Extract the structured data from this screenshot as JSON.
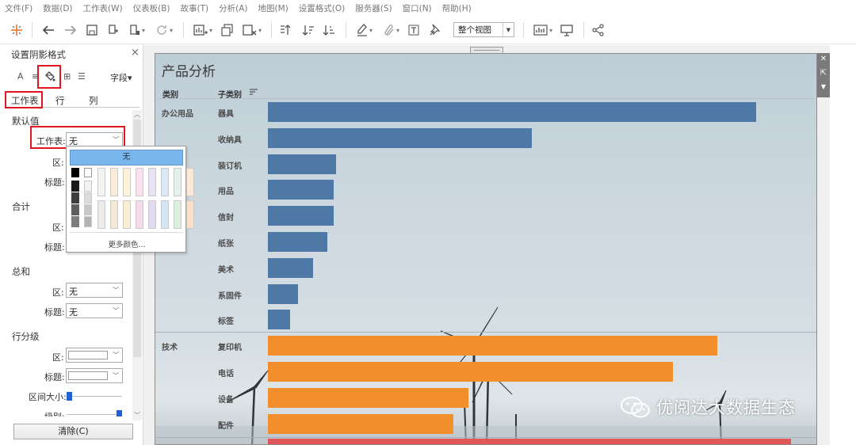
{
  "menubar": [
    "文件(F)",
    "数据(D)",
    "工作表(W)",
    "仪表板(B)",
    "故事(T)",
    "分析(A)",
    "地图(M)",
    "设置格式(O)",
    "服务器(S)",
    "窗口(N)",
    "帮助(H)"
  ],
  "toolbar": {
    "view_select": "整个视图",
    "icons": [
      "tableau-logo-icon",
      "undo-icon",
      "redo-icon",
      "save-icon",
      "new-datasource-icon",
      "pause-update-icon",
      "refresh-icon",
      "new-worksheet-icon",
      "duplicate-sheet-icon",
      "clear-sheet-icon",
      "swap-axes-icon",
      "sort-ascending-icon",
      "sort-descending-icon",
      "highlight-icon",
      "group-icon",
      "show-labels-icon",
      "pin-axes-icon",
      "show-me-icon",
      "presentation-icon",
      "share-icon"
    ]
  },
  "format_pane": {
    "title": "设置阴影格式",
    "close": "×",
    "tab_icons": [
      "A",
      "≡",
      "◈",
      "⊞",
      "☰"
    ],
    "field_dropdown": "字段▾",
    "subtabs": [
      "工作表",
      "行",
      "列"
    ],
    "sections": {
      "default": {
        "title": "默认值",
        "worksheet_label": "工作表:",
        "worksheet_value": "无",
        "area_label": "区:",
        "header_label": "标题:"
      },
      "total": {
        "title": "合计",
        "area_label": "区:",
        "header_label": "标题:"
      },
      "grand_total": {
        "title": "总和",
        "area_label": "区:",
        "area_value": "无",
        "header_label": "标题:",
        "header_value": "无"
      },
      "row_banding": {
        "title": "行分级",
        "area_label": "区:",
        "header_label": "标题:",
        "band_size_label": "区间大小:",
        "level_label": "级别:",
        "band_size_value": 0,
        "level_value": 1
      }
    },
    "clear_button": "清除(C)"
  },
  "palette": {
    "none_label": "无",
    "more_colors": "更多颜色...",
    "colors": {
      "black": "#000000",
      "white": "#ffffff",
      "selected_blue": "#79b6ec"
    }
  },
  "sheet": {
    "title": "产品分析",
    "col_headers": [
      "类别",
      "子类别"
    ],
    "sort_icon": "sort-icon",
    "colors": {
      "office": "#4e79a7",
      "tech": "#f28e2b",
      "furniture": "#e15759"
    }
  },
  "chart_data": {
    "type": "bar",
    "orientation": "horizontal",
    "groups": [
      {
        "name": "办公用品",
        "categories": [
          "器具",
          "收纳具",
          "装订机",
          "用品",
          "信封",
          "纸张",
          "美术",
          "系固件",
          "标签"
        ],
        "values": [
          100,
          54,
          14,
          13.5,
          13.5,
          12.2,
          9.2,
          6.1,
          4.6
        ]
      },
      {
        "name": "技术",
        "categories": [
          "复印机",
          "电话",
          "设备",
          "配件"
        ],
        "values": [
          92,
          83,
          41,
          38
        ]
      }
    ],
    "xlabel": "",
    "ylabel": "",
    "grid": false
  },
  "watermark": "优阅达大数据生态"
}
